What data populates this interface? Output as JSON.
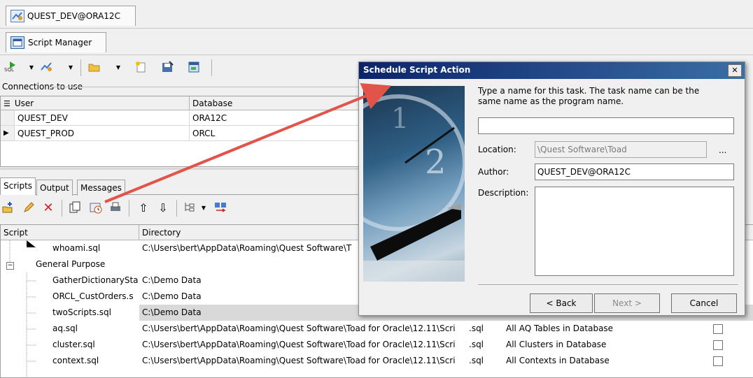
{
  "connection_tab": {
    "label": "QUEST_DEV@ORA12C",
    "icon": "connection-icon"
  },
  "script_manager_tab": {
    "label": "Script Manager",
    "icon": "script-manager-icon"
  },
  "toolbar": {
    "icons": [
      "run-script-icon",
      "dropdown-arrow-icon",
      "connection-icon",
      "dropdown-arrow-icon",
      "open-folder-icon",
      "dropdown-arrow-icon",
      "new-file-icon",
      "save-icon",
      "settings-window-icon"
    ]
  },
  "connections": {
    "group_label": "Connections to use",
    "columns": [
      "User",
      "Database"
    ],
    "rows": [
      {
        "user": "QUEST_DEV",
        "database": "ORA12C",
        "current": false
      },
      {
        "user": "QUEST_PROD",
        "database": "ORCL",
        "current": true
      }
    ]
  },
  "bottom_tabs": [
    "Scripts",
    "Output",
    "Messages"
  ],
  "scripts_grid": {
    "columns": [
      "Script",
      "Directory"
    ],
    "rows": [
      {
        "script": "whoami.sql",
        "directory": "C:\\Users\\bert\\AppData\\Roaming\\Quest Software\\T",
        "ext": "",
        "desc": "",
        "indent": 2
      },
      {
        "script": "General Purpose",
        "directory": "",
        "ext": "",
        "desc": "",
        "indent": 1,
        "group": true
      },
      {
        "script": "GatherDictionarySta",
        "directory": "C:\\Demo Data",
        "ext": "",
        "desc": "",
        "indent": 2
      },
      {
        "script": "ORCL_CustOrders.s",
        "directory": "C:\\Demo Data",
        "ext": "",
        "desc": "",
        "indent": 2
      },
      {
        "script": "twoScripts.sql",
        "directory": "C:\\Demo Data",
        "ext": "",
        "desc": "",
        "indent": 2,
        "selected": true
      },
      {
        "script": "aq.sql",
        "directory": "C:\\Users\\bert\\AppData\\Roaming\\Quest Software\\Toad for Oracle\\12.11\\Scri",
        "ext": ".sql",
        "desc": "All AQ Tables in Database",
        "indent": 2
      },
      {
        "script": "cluster.sql",
        "directory": "C:\\Users\\bert\\AppData\\Roaming\\Quest Software\\Toad for Oracle\\12.11\\Scri",
        "ext": ".sql",
        "desc": "All Clusters in Database",
        "indent": 2
      },
      {
        "script": "context.sql",
        "directory": "C:\\Users\\bert\\AppData\\Roaming\\Quest Software\\Toad for Oracle\\12.11\\Scri",
        "ext": ".sql",
        "desc": "All Contexts in Database",
        "indent": 2
      }
    ]
  },
  "dialog": {
    "title": "Schedule Script Action",
    "close_glyph": "✕",
    "instructions": "Type a name for this task.  The task name can be the same name as the program name.",
    "task_name_value": "",
    "location_label": "Location:",
    "location_value": "\\Quest Software\\Toad",
    "browse_label": "...",
    "author_label": "Author:",
    "author_value": "QUEST_DEV@ORA12C",
    "description_label": "Description:",
    "description_value": "",
    "back_button": "< Back",
    "next_button": "Next >",
    "cancel_button": "Cancel"
  },
  "colors": {
    "arrow": "#e2534a",
    "dialog_title": "#0a246a",
    "selection": "#d9d9d9"
  }
}
